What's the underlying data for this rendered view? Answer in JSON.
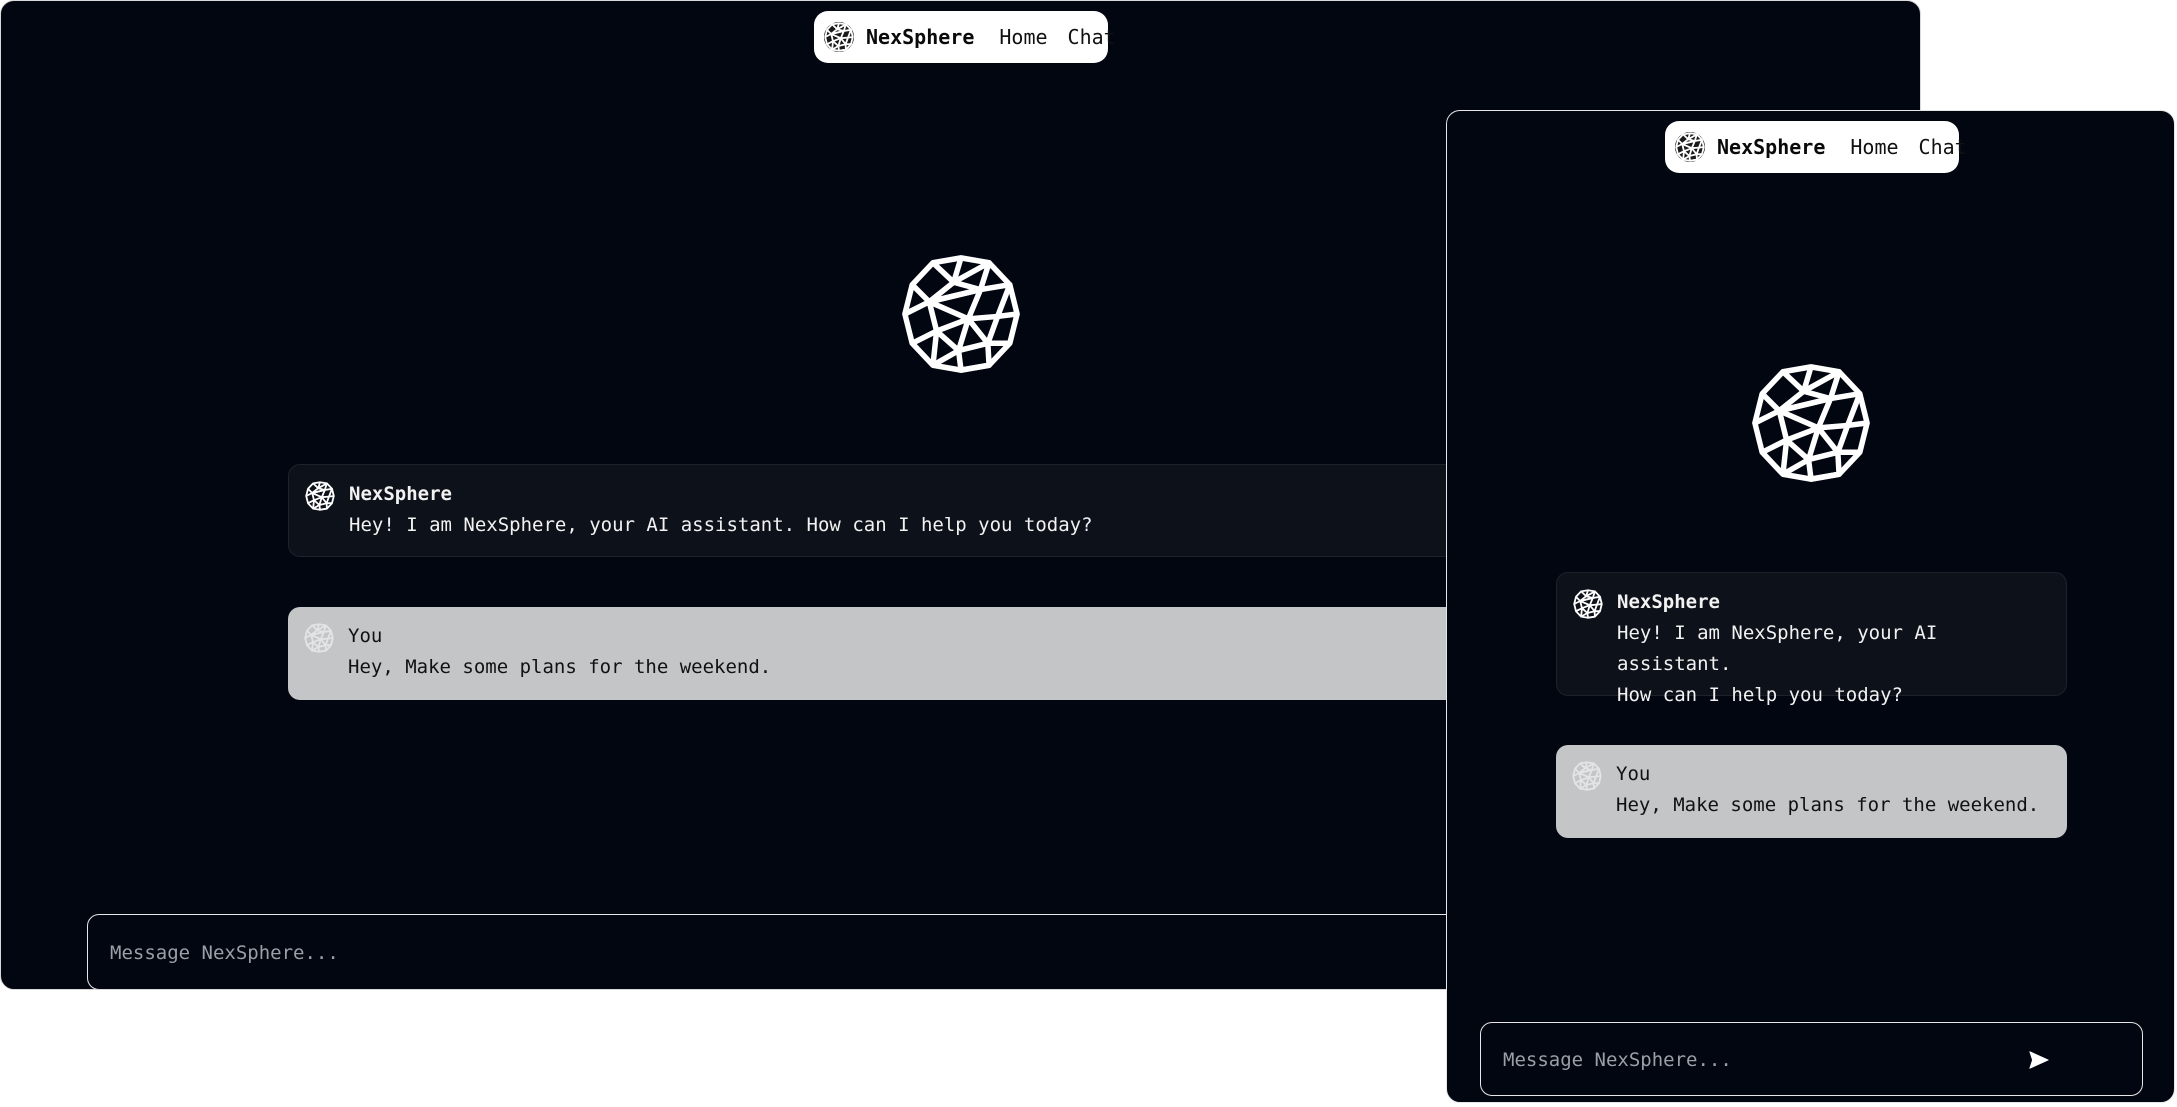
{
  "colors": {
    "background": "#020611",
    "nav_background": "#ffffff",
    "bot_bubble": "#0d1119",
    "user_bubble": "#c4c5c7",
    "accent": "#ffffff"
  },
  "icons": {
    "brand": "geodesic-sphere-icon",
    "send": "paper-plane-send-icon"
  },
  "desktop": {
    "nav": {
      "brand": "NexSphere",
      "links": [
        "Home",
        "Chat"
      ]
    },
    "messages": [
      {
        "sender": "NexSphere",
        "text": "Hey! I am NexSphere, your AI assistant. How can I help you today?"
      },
      {
        "sender": "You",
        "text": "Hey, Make some plans for the weekend."
      }
    ],
    "composer": {
      "placeholder": "Message NexSphere..."
    }
  },
  "mobile": {
    "nav": {
      "brand": "NexSphere",
      "links": [
        "Home",
        "Chat"
      ]
    },
    "messages": [
      {
        "sender": "NexSphere",
        "text_lines": [
          "Hey! I am NexSphere, your AI assistant.",
          "How can I help you today?"
        ]
      },
      {
        "sender": "You",
        "text": "Hey, Make some plans for the weekend."
      }
    ],
    "composer": {
      "placeholder": "Message NexSphere..."
    }
  }
}
